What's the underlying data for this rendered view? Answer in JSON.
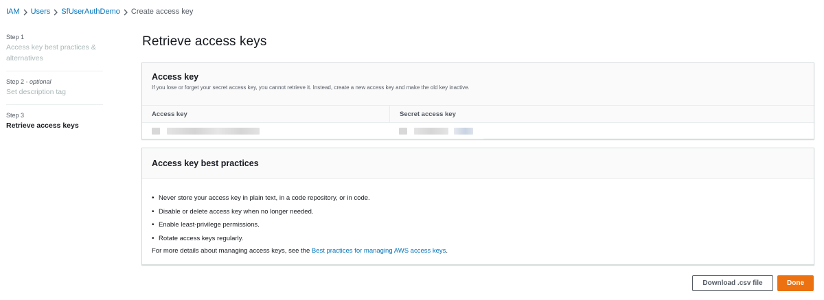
{
  "breadcrumb": {
    "items": [
      "IAM",
      "Users",
      "SfUserAuthDemo"
    ],
    "current": "Create access key"
  },
  "steps": [
    {
      "number": "Step 1",
      "title": "Access key best practices & alternatives"
    },
    {
      "number": "Step 2",
      "optional": "optional",
      "title": "Set description tag"
    },
    {
      "number": "Step 3",
      "title": "Retrieve access keys"
    }
  ],
  "page": {
    "title": "Retrieve access keys"
  },
  "access_key_panel": {
    "title": "Access key",
    "description": "If you lose or forget your secret access key, you cannot retrieve it. Instead, create a new access key and make the old key inactive.",
    "columns": [
      "Access key",
      "Secret access key"
    ]
  },
  "best_practices_panel": {
    "title": "Access key best practices",
    "items": [
      "Never store your access key in plain text, in a code repository, or in code.",
      "Disable or delete access key when no longer needed.",
      "Enable least-privilege permissions.",
      "Rotate access keys regularly."
    ],
    "more_prefix": "For more details about managing access keys, see the ",
    "more_link": "Best practices for managing AWS access keys",
    "more_suffix": "."
  },
  "actions": {
    "download": "Download .csv file",
    "done": "Done"
  },
  "colors": {
    "link": "#0073bb",
    "primary": "#ec7211"
  }
}
